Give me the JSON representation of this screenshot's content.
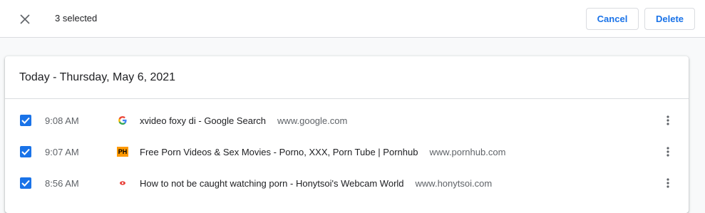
{
  "toolbar": {
    "selected_text": "3 selected",
    "cancel_label": "Cancel",
    "delete_label": "Delete",
    "close_icon": "close-icon",
    "accent_color": "#1a73e8"
  },
  "history": {
    "date_header": "Today - Thursday, May 6, 2021",
    "items": [
      {
        "checked": true,
        "time": "9:08 AM",
        "favicon": "google-favicon-icon",
        "title": "xvideo foxy di - Google Search",
        "domain": "www.google.com"
      },
      {
        "checked": true,
        "time": "9:07 AM",
        "favicon": "pornhub-favicon-icon",
        "favicon_text": "PH",
        "title": "Free Porn Videos & Sex Movies - Porno, XXX, Porn Tube | Pornhub",
        "domain": "www.pornhub.com"
      },
      {
        "checked": true,
        "time": "8:56 AM",
        "favicon": "honytsoi-favicon-icon",
        "title": "How to not be caught watching porn - Honytsoi's Webcam World",
        "domain": "www.honytsoi.com"
      }
    ]
  }
}
